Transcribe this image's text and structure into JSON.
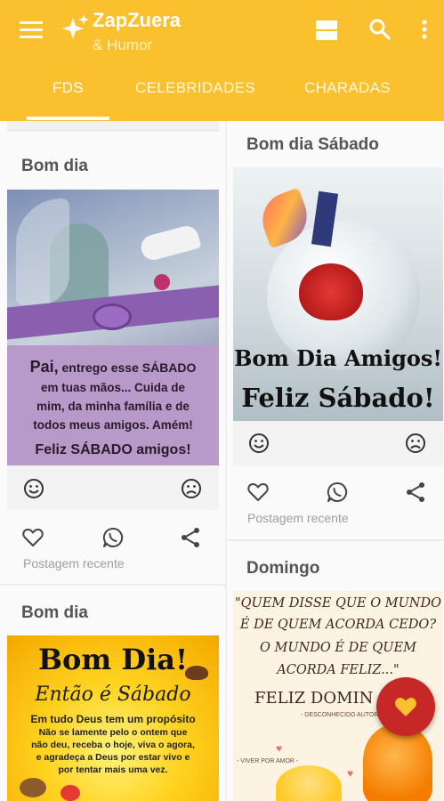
{
  "app": {
    "title": "ZapZuera",
    "subtitle": "& Humor"
  },
  "tabs": [
    {
      "label": "FDS",
      "active": true
    },
    {
      "label": "CELEBRIDADES",
      "active": false
    },
    {
      "label": "CHARADAS",
      "active": false
    }
  ],
  "colors": {
    "accent": "#fbc02d",
    "fab": "#c62828",
    "fab_icon": "#fbc02d"
  },
  "icons": {
    "menu": "hamburger-menu-icon",
    "logo": "sparkle-icon",
    "view_toggle": "grid-view-icon",
    "search": "search-icon",
    "more": "more-vert-icon",
    "like": "heart-icon",
    "whatsapp": "whatsapp-icon",
    "share": "share-icon",
    "happy": "smile-icon",
    "sad": "frown-icon",
    "fab": "favorite-heart-icon"
  },
  "feed": {
    "left": [
      {
        "title": "Bom dia",
        "image": {
          "line1_bold": "Pai,",
          "line1_rest": " entrego esse SÁBADO",
          "lines": [
            "em tuas mãos...  Cuida de",
            "mim, da minha família e de",
            "todos meus amigos. Amém!"
          ],
          "footer": "Feliz SÁBADO amigos!"
        },
        "recent_label": "Postagem recente"
      },
      {
        "title": "Bom dia",
        "image": {
          "headline": "Bom Dia!",
          "subhead": "Então é Sábado",
          "lines": [
            "Em tudo Deus tem um propósito",
            "Não se lamente pelo o ontem que",
            "não deu, receba o hoje, viva o agora,",
            "e agradeça a Deus por estar vivo e",
            "por tentar mais uma vez."
          ]
        }
      }
    ],
    "right": [
      {
        "title": "Bom dia Sábado",
        "image": {
          "line1": "Bom Dia Amigos!",
          "line2": "Feliz Sábado!"
        },
        "recent_label": "Postagem recente"
      },
      {
        "title": "Domingo",
        "image": {
          "quote": [
            "\"QUEM DISSE QUE O MUNDO",
            "É DE QUEM ACORDA CEDO?",
            "O MUNDO É DE QUEM",
            "ACORDA FELIZ...\""
          ],
          "greeting": "FELIZ DOMIN",
          "author": "- DESCONHECIDO AUTOR -",
          "tagline": "- VIVER POR AMOR -"
        }
      }
    ]
  }
}
